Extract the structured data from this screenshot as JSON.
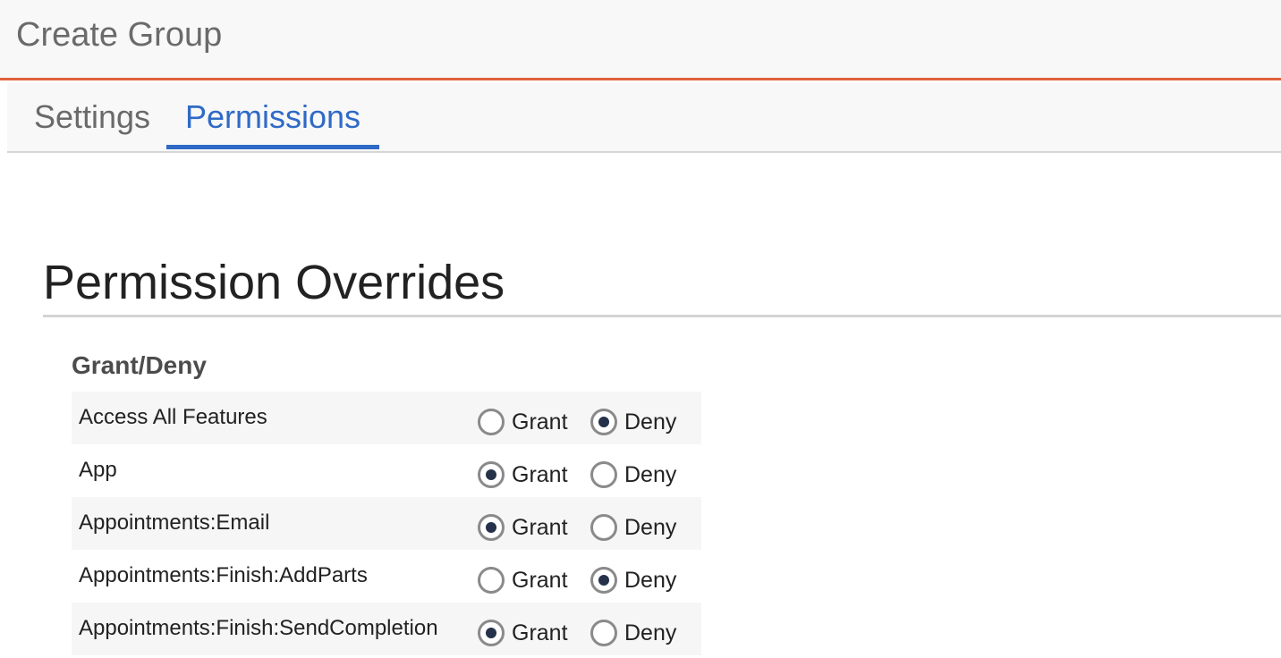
{
  "header": {
    "title": "Create Group"
  },
  "tabs": [
    {
      "label": "Settings",
      "active": false
    },
    {
      "label": "Permissions",
      "active": true
    }
  ],
  "colors": {
    "accent": "#e0623c",
    "active_tab": "#2f6ac6",
    "radio_dot": "#25324a"
  },
  "permissions": {
    "section_title": "Permission Overrides",
    "group_heading": "Grant/Deny",
    "grant_label": "Grant",
    "deny_label": "Deny",
    "rows": [
      {
        "name": "Access All Features",
        "selected": "Deny"
      },
      {
        "name": "App",
        "selected": "Grant"
      },
      {
        "name": "Appointments:Email",
        "selected": "Grant"
      },
      {
        "name": "Appointments:Finish:AddParts",
        "selected": "Deny"
      },
      {
        "name": "Appointments:Finish:SendCompletion",
        "selected": "Grant"
      }
    ]
  }
}
